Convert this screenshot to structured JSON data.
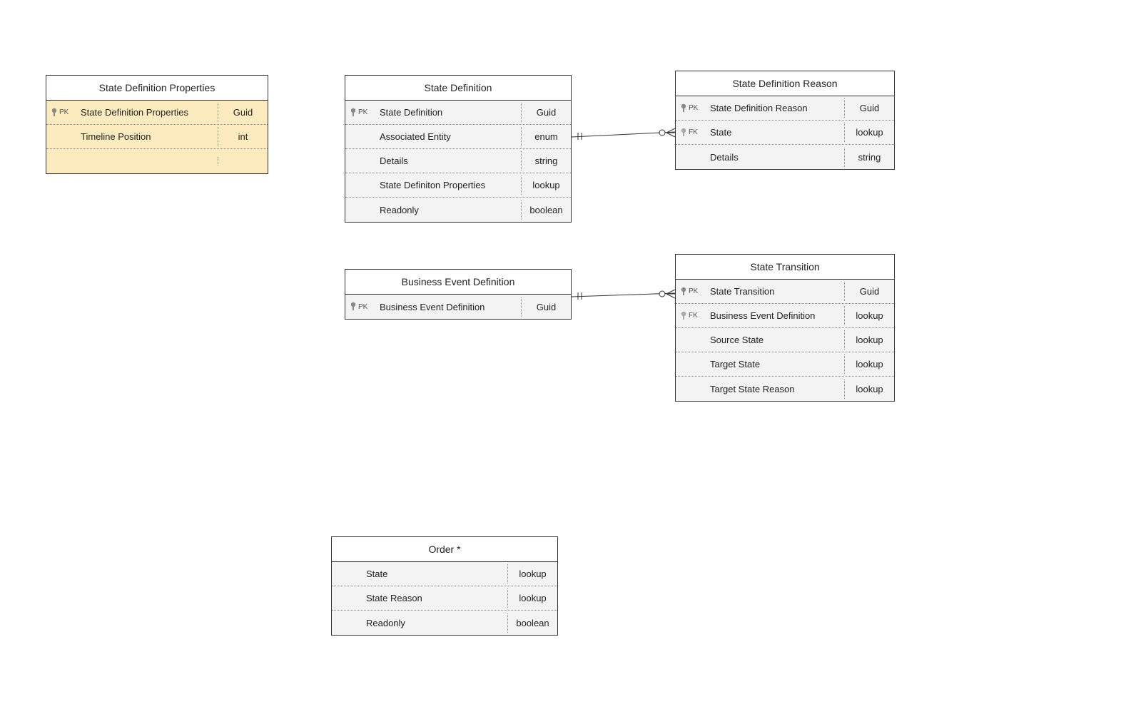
{
  "entities": {
    "stateDefProps": {
      "title": "State Definition Properties",
      "rows": [
        {
          "key": "PK",
          "name": "State Definition Properties",
          "type": "Guid"
        },
        {
          "key": "",
          "name": "Timeline Position",
          "type": "int"
        }
      ]
    },
    "stateDef": {
      "title": "State Definition",
      "rows": [
        {
          "key": "PK",
          "name": "State Definition",
          "type": "Guid"
        },
        {
          "key": "",
          "name": "Associated Entity",
          "type": "enum"
        },
        {
          "key": "",
          "name": "Details",
          "type": "string"
        },
        {
          "key": "",
          "name": "State Definiton Properties",
          "type": "lookup"
        },
        {
          "key": "",
          "name": "Readonly",
          "type": "boolean"
        }
      ]
    },
    "stateDefReason": {
      "title": "State Definition Reason",
      "rows": [
        {
          "key": "PK",
          "name": "State Definition Reason",
          "type": "Guid"
        },
        {
          "key": "FK",
          "name": "State",
          "type": "lookup"
        },
        {
          "key": "",
          "name": "Details",
          "type": "string"
        }
      ]
    },
    "bizEventDef": {
      "title": "Business Event Definition",
      "rows": [
        {
          "key": "PK",
          "name": "Business Event Definition",
          "type": "Guid"
        }
      ]
    },
    "stateTransition": {
      "title": "State Transition",
      "rows": [
        {
          "key": "PK",
          "name": "State Transition",
          "type": "Guid"
        },
        {
          "key": "FK",
          "name": "Business Event Definition",
          "type": "lookup"
        },
        {
          "key": "",
          "name": "Source State",
          "type": "lookup"
        },
        {
          "key": "",
          "name": "Target State",
          "type": "lookup"
        },
        {
          "key": "",
          "name": "Target State Reason",
          "type": "lookup"
        }
      ]
    },
    "order": {
      "title": "Order *",
      "rows": [
        {
          "key": "",
          "name": "State",
          "type": "lookup"
        },
        {
          "key": "",
          "name": "State Reason",
          "type": "lookup"
        },
        {
          "key": "",
          "name": "Readonly",
          "type": "boolean"
        }
      ]
    }
  },
  "relationships": [
    {
      "from": "stateDef",
      "to": "stateDefReason",
      "cardinality": "one-to-many"
    },
    {
      "from": "bizEventDef",
      "to": "stateTransition",
      "cardinality": "one-to-many"
    }
  ]
}
